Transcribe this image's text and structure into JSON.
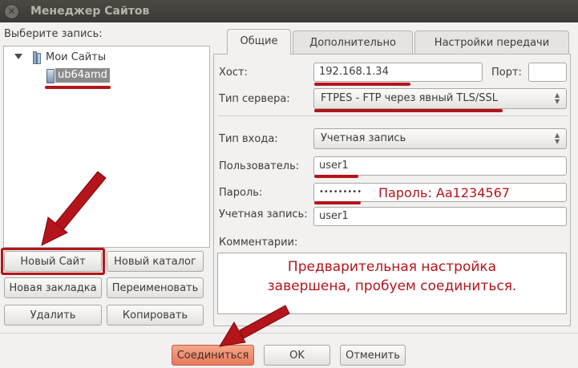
{
  "window": {
    "title": "Менеджер Сайтов"
  },
  "left": {
    "select_label": "Выберите запись:",
    "tree": {
      "root": "Мои Сайты",
      "child": "ub64amd"
    }
  },
  "buttons": {
    "new_site": "Новый Сайт",
    "new_folder": "Новый каталог",
    "new_bookmark": "Новая закладка",
    "rename": "Переименовать",
    "delete": "Удалить",
    "copy": "Копировать",
    "connect": "Соединиться",
    "ok": "OK",
    "cancel": "Отменить"
  },
  "tabs": [
    {
      "label": "Общие",
      "active": true
    },
    {
      "label": "Дополнительно",
      "active": false
    },
    {
      "label": "Настройки передачи",
      "active": false
    }
  ],
  "form": {
    "host_label": "Хост:",
    "host_value": "192.168.1.34",
    "port_label": "Порт:",
    "port_value": "",
    "server_type_label": "Тип сервера:",
    "server_type_value": "FTPES - FTP через явный TLS/SSL",
    "logon_type_label": "Тип входа:",
    "logon_type_value": "Учетная запись",
    "user_label": "Пользователь:",
    "user_value": "user1",
    "password_label": "Пароль:",
    "password_value": "•••••••••",
    "account_label": "Учетная запись:",
    "account_value": "user1",
    "comments_label": "Комментарии:"
  },
  "annotations": {
    "password_hint": "Пароль: Aa1234567",
    "comment_line1": "Предварительная настройка",
    "comment_line2": "завершена, пробуем соединиться."
  },
  "colors": {
    "annotation_red": "#b5141a",
    "connect_button": "#e8795a"
  }
}
